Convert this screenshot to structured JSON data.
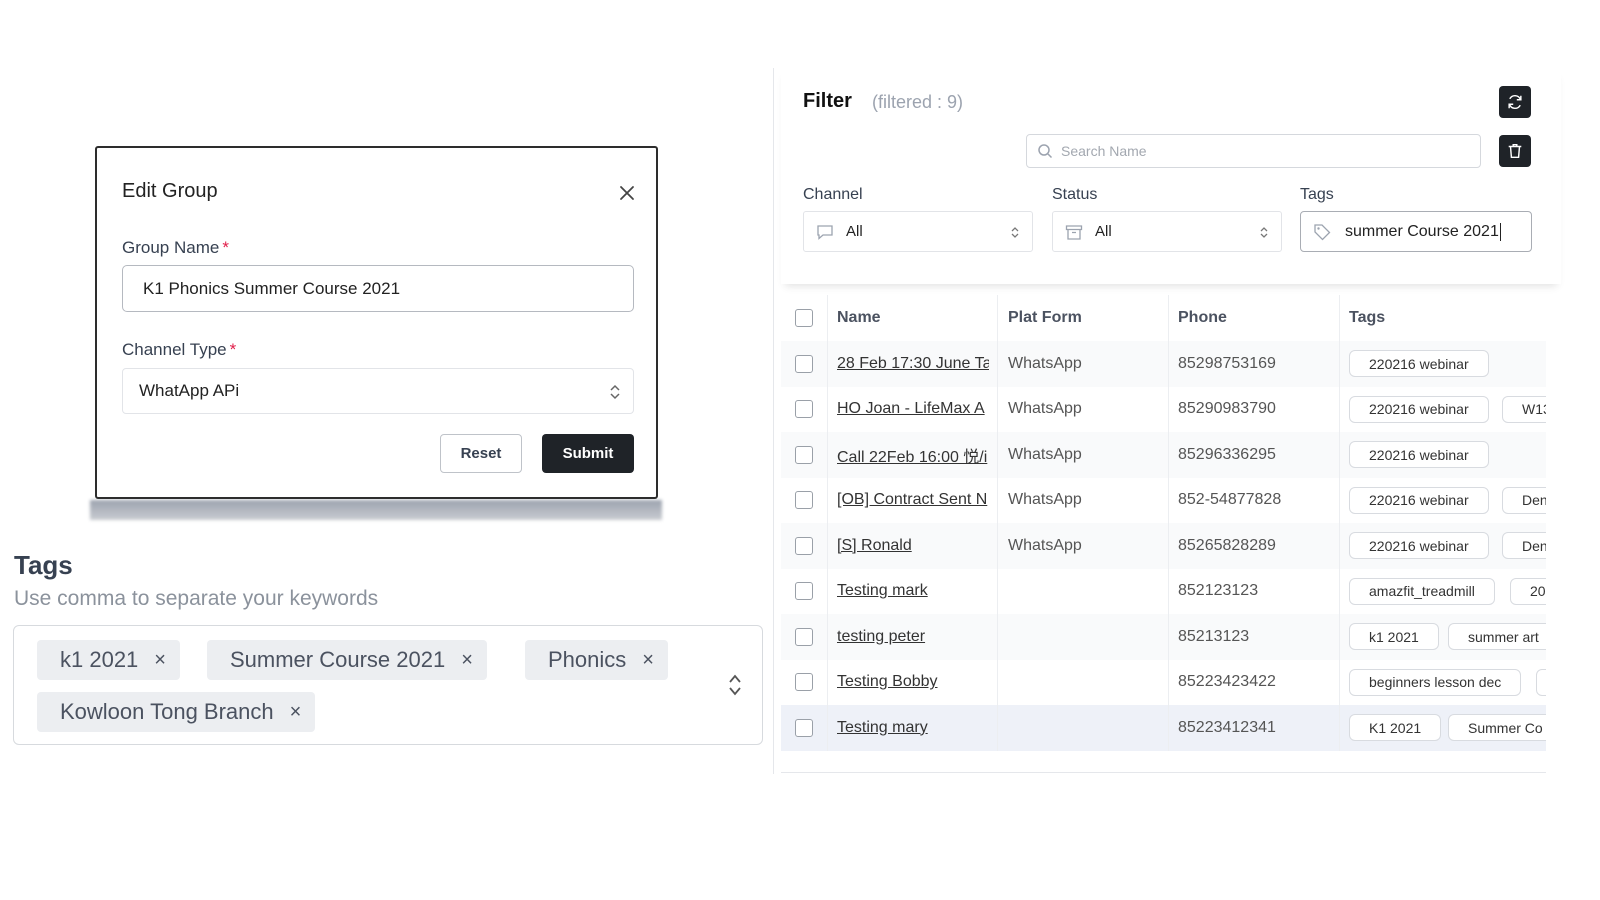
{
  "edit_group": {
    "title": "Edit Group",
    "group_name_label": "Group Name",
    "required_mark": "*",
    "group_name_value": "K1 Phonics Summer Course 2021",
    "channel_type_label": "Channel Type",
    "channel_type_value": "WhatApp APi",
    "reset_label": "Reset",
    "submit_label": "Submit",
    "icons": {
      "close": "close-icon",
      "select": "chevron-updown-icon"
    }
  },
  "tags_input": {
    "title": "Tags",
    "help": "Use comma to separate your keywords",
    "remove_glyph": "×",
    "chips": [
      "k1 2021",
      "Summer Course 2021",
      "Phonics",
      "Kowloon Tong Branch"
    ]
  },
  "filter": {
    "title": "Filter",
    "count": "(filtered : 9)",
    "search_placeholder": "Search Name",
    "channel_label": "Channel",
    "channel_value": "All",
    "status_label": "Status",
    "status_value": "All",
    "tags_label": "Tags",
    "tags_value": "summer Course 2021",
    "icons": {
      "refresh": "refresh-icon",
      "delete": "trash-icon",
      "search": "search-icon",
      "channel": "chat-icon",
      "status": "archive-icon",
      "tags": "tag-icon"
    },
    "colors": {
      "icon_button": "#1f2328",
      "selected_row": "#eef1f8"
    }
  },
  "table": {
    "headers": {
      "name": "Name",
      "platform": "Plat Form",
      "phone": "Phone",
      "tags": "Tags"
    },
    "rows": [
      {
        "name": "28 Feb 17:30 June Ta",
        "platform": "WhatsApp",
        "phone": "85298753169",
        "tags": [
          "220216 webinar"
        ]
      },
      {
        "name": "HO Joan - LifeMax A",
        "platform": "WhatsApp",
        "phone": "85290983790",
        "tags": [
          "220216 webinar",
          "W13"
        ]
      },
      {
        "name": "Call 22Feb 16:00 悦/i",
        "platform": "WhatsApp",
        "phone": "85296336295",
        "tags": [
          "220216 webinar"
        ]
      },
      {
        "name": "[OB] Contract Sent N",
        "platform": "WhatsApp",
        "phone": "852-54877828",
        "tags": [
          "220216 webinar",
          "Den"
        ]
      },
      {
        "name": "[S] Ronald",
        "platform": "WhatsApp",
        "phone": "85265828289",
        "tags": [
          "220216 webinar",
          "Den"
        ]
      },
      {
        "name": "Testing mark",
        "platform": "",
        "phone": "852123123",
        "tags": [
          "amazfit_treadmill",
          "20"
        ]
      },
      {
        "name": "testing peter",
        "platform": "",
        "phone": "85213123",
        "tags": [
          "k1 2021",
          "summer art"
        ]
      },
      {
        "name": "Testing Bobby",
        "platform": "",
        "phone": "85223423422",
        "tags": [
          "beginners lesson dec",
          ""
        ]
      },
      {
        "name": "Testing mary",
        "platform": "",
        "phone": "85223412341",
        "tags": [
          "K1 2021",
          "Summer Co"
        ]
      }
    ]
  }
}
